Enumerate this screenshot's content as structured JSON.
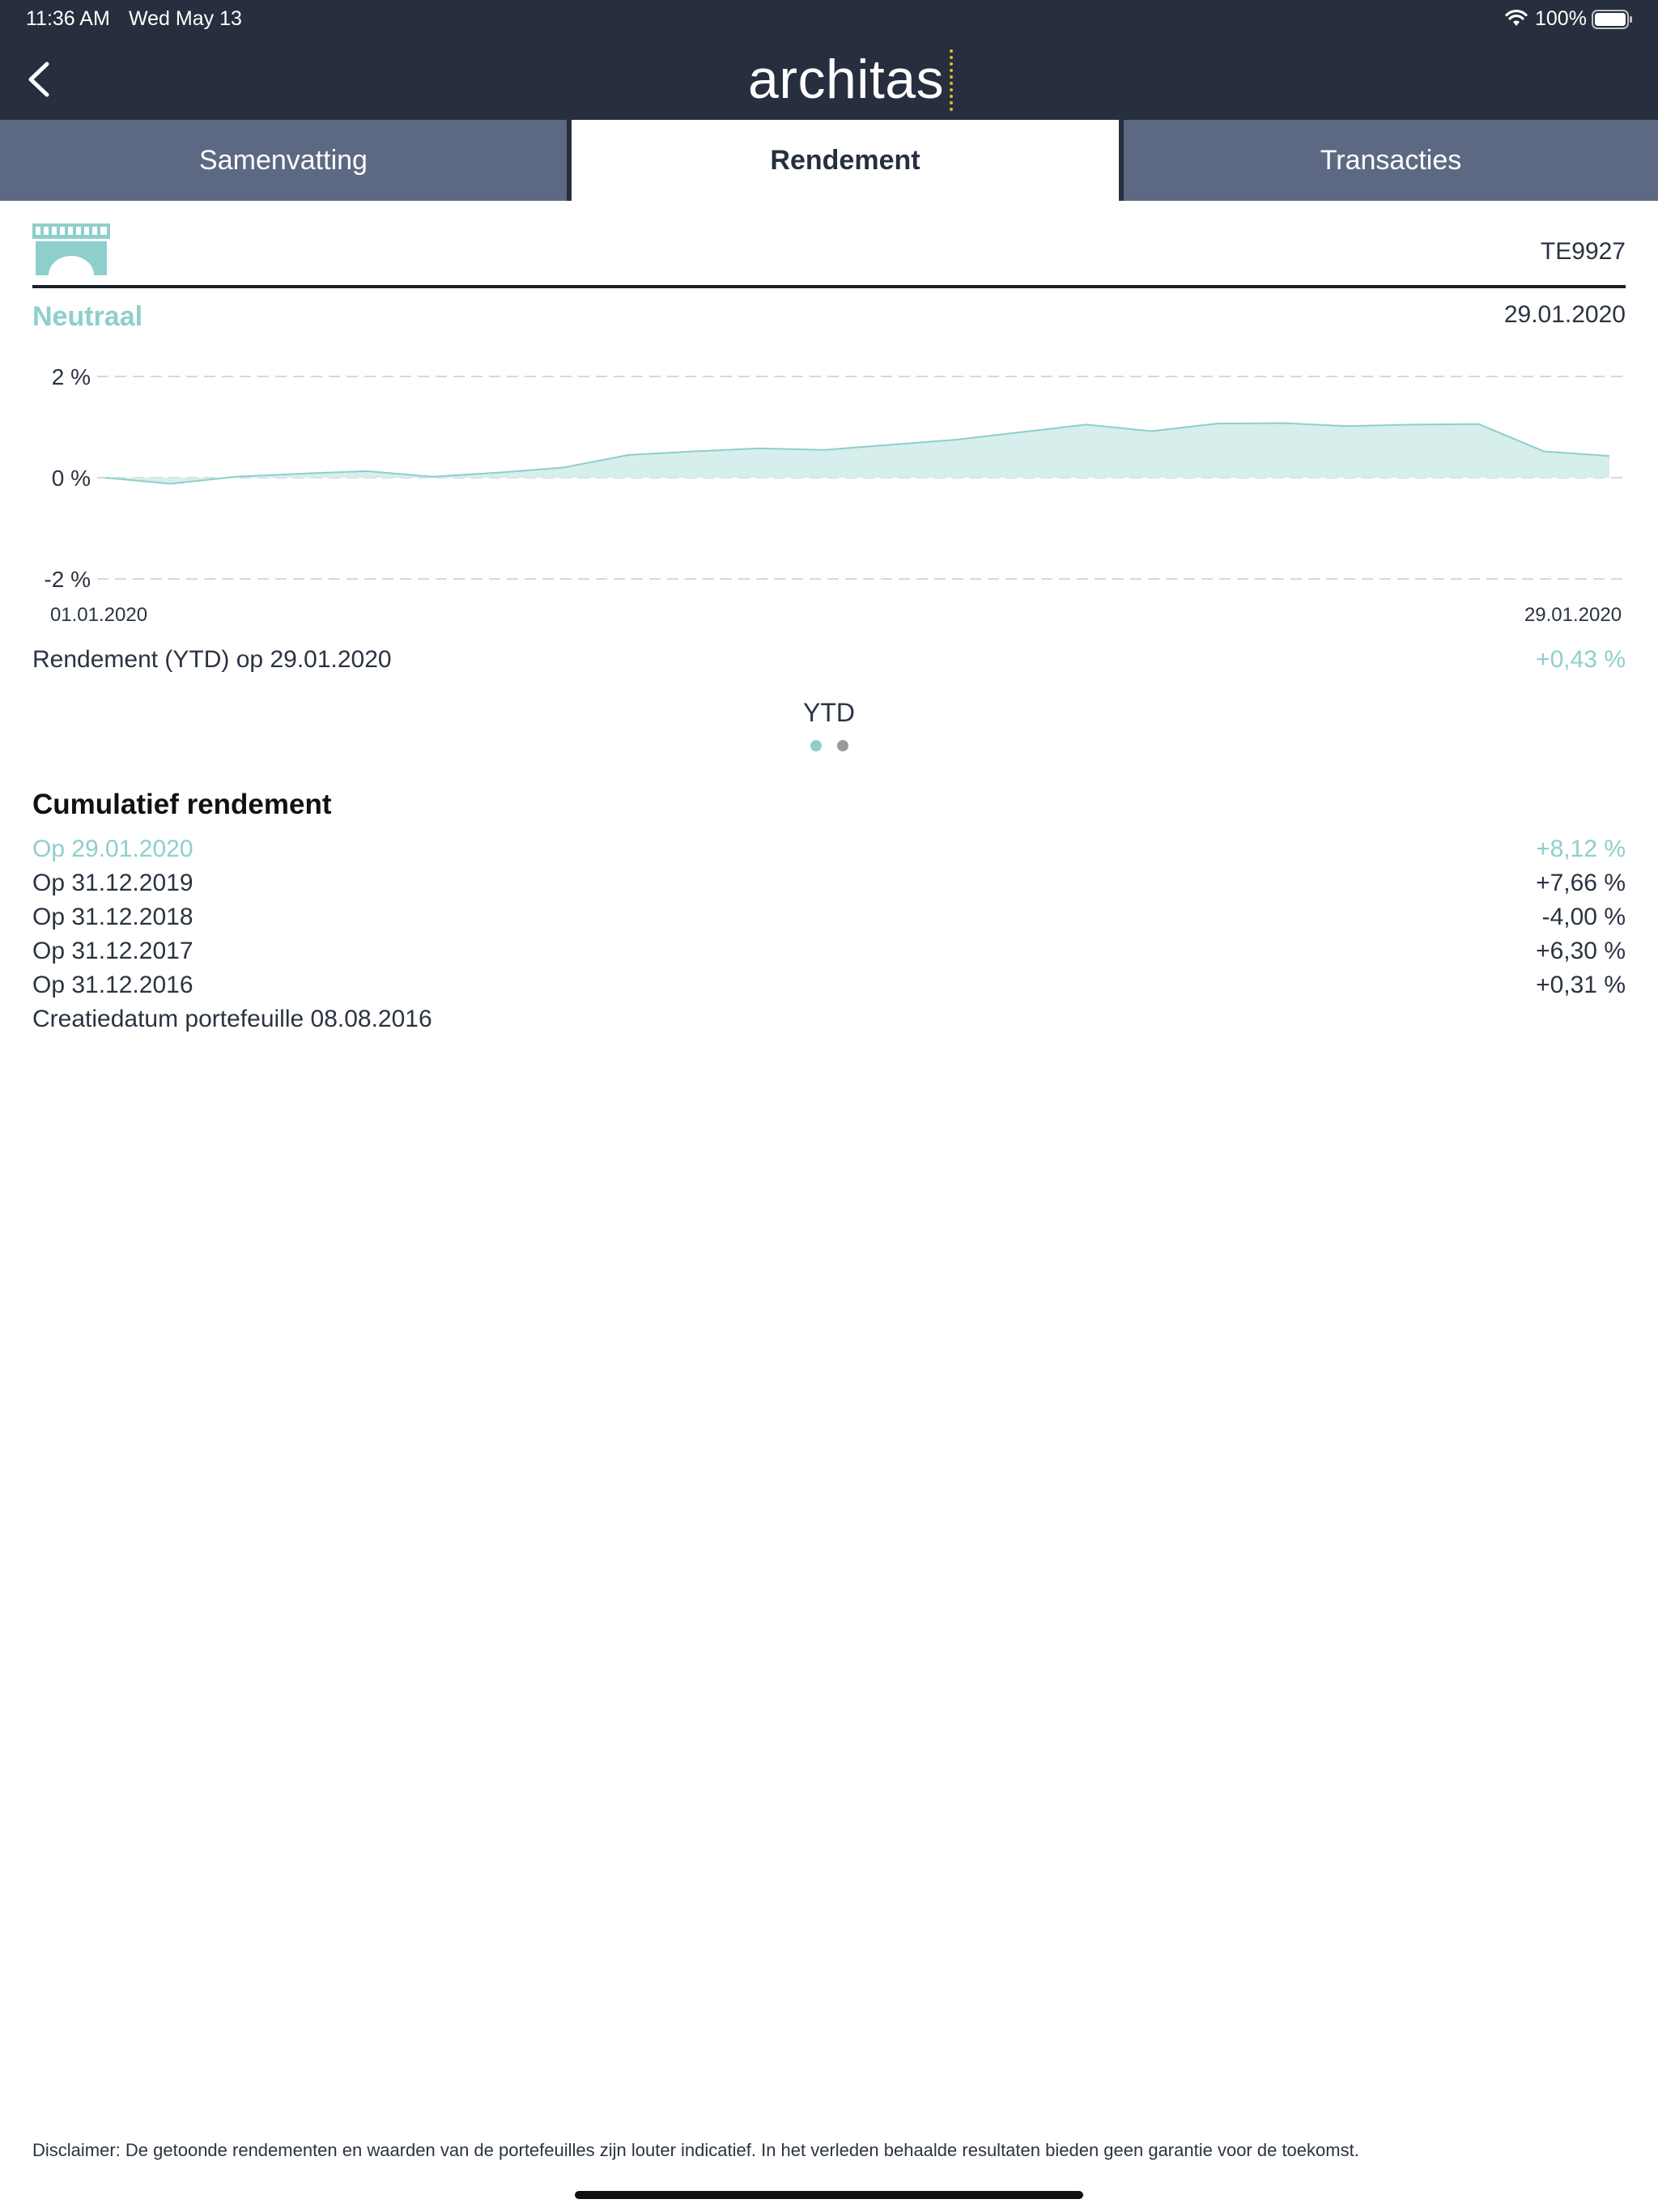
{
  "status_bar": {
    "time": "11:36 AM",
    "date": "Wed May 13",
    "battery": "100%"
  },
  "header": {
    "logo_text": "architas",
    "logo_accent_color": "#e8b62c"
  },
  "tabs": [
    {
      "label": "Samenvatting",
      "active": false
    },
    {
      "label": "Rendement",
      "active": true
    },
    {
      "label": "Transacties",
      "active": false
    }
  ],
  "portfolio": {
    "id": "TE9927",
    "profile": "Neutraal",
    "date": "29.01.2020"
  },
  "chart_data": {
    "type": "area",
    "y_tick_labels": [
      "2 %",
      "0 %",
      "-2 %"
    ],
    "y_ticks": [
      2,
      0,
      -2
    ],
    "ylim": [
      -2,
      2
    ],
    "x_start_label": "01.01.2020",
    "x_end_label": "29.01.2020",
    "x": [
      "01.01",
      "02.01",
      "03.01",
      "06.01",
      "07.01",
      "08.01",
      "09.01",
      "10.01",
      "13.01",
      "14.01",
      "15.01",
      "16.01",
      "17.01",
      "20.01",
      "21.01",
      "22.01",
      "23.01",
      "24.01",
      "27.01",
      "28.01",
      "29.01"
    ],
    "values": [
      0.0,
      -0.12,
      0.02,
      0.08,
      0.13,
      0.02,
      0.1,
      0.2,
      0.45,
      0.52,
      0.58,
      0.55,
      0.65,
      0.75,
      0.9,
      1.05,
      0.92,
      1.07,
      1.08,
      1.02,
      1.05,
      1.06,
      0.52,
      0.43
    ],
    "line_color": "#8ecfcb",
    "fill_color": "#d6eeec",
    "grid": true
  },
  "ytd": {
    "label": "Rendement (YTD) op 29.01.2020",
    "value": "+0,43 %",
    "period": "YTD"
  },
  "pager": {
    "count": 2,
    "active_index": 0
  },
  "cumulative": {
    "title": "Cumulatief rendement",
    "rows": [
      {
        "label": "Op 29.01.2020",
        "value": "+8,12 %",
        "highlight": true
      },
      {
        "label": "Op 31.12.2019",
        "value": "+7,66 %",
        "highlight": false
      },
      {
        "label": "Op 31.12.2018",
        "value": "-4,00 %",
        "highlight": false
      },
      {
        "label": "Op 31.12.2017",
        "value": "+6,30 %",
        "highlight": false
      },
      {
        "label": "Op 31.12.2016",
        "value": "+0,31 %",
        "highlight": false
      }
    ],
    "creation": "Creatiedatum portefeuille 08.08.2016"
  },
  "disclaimer": "Disclaimer: De getoonde rendementen en waarden van de portefeuilles zijn louter indicatief. In het verleden behaalde resultaten bieden geen garantie voor de toekomst.",
  "colors": {
    "navy": "#272f3e",
    "tab_inactive": "#5d6983",
    "teal": "#8ecfcb",
    "text": "#2b3342"
  }
}
